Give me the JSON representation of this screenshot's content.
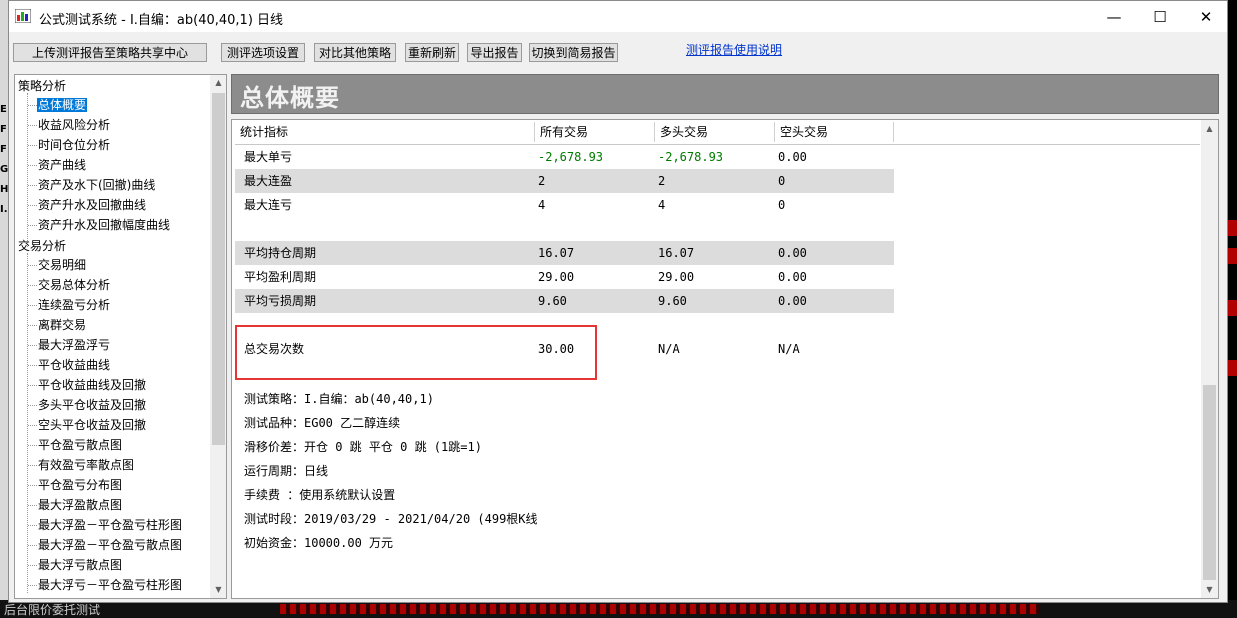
{
  "window": {
    "title": "公式测试系统 - I.自编：ab(40,40,1) 日线",
    "controls": {
      "minimize": "—",
      "maximize": "☐",
      "close": "✕"
    }
  },
  "toolbar": {
    "upload": "上传测评报告至策略共享中心",
    "options": "测评选项设置",
    "compare": "对比其他策略",
    "refresh": "重新刷新",
    "export": "导出报告",
    "simple": "切换到简易报告",
    "help_link": "测评报告使用说明"
  },
  "tree": {
    "group1": "策略分析",
    "group1_items": [
      "总体概要",
      "收益风险分析",
      "时间仓位分析",
      "资产曲线",
      "资产及水下(回撤)曲线",
      "资产升水及回撤曲线",
      "资产升水及回撤幅度曲线"
    ],
    "group2": "交易分析",
    "group2_items": [
      "交易明细",
      "交易总体分析",
      "连续盈亏分析",
      "离群交易",
      "最大浮盈浮亏",
      "平仓收益曲线",
      "平仓收益曲线及回撤",
      "多头平仓收益及回撤",
      "空头平仓收益及回撤",
      "平仓盈亏散点图",
      "有效盈亏率散点图",
      "平仓盈亏分布图",
      "最大浮盈散点图",
      "最大浮盈－平仓盈亏柱形图",
      "最大浮盈－平仓盈亏散点图",
      "最大浮亏散点图",
      "最大浮亏－平仓盈亏柱形图"
    ]
  },
  "banner": {
    "title": "总体概要"
  },
  "table": {
    "headers": [
      "统计指标",
      "所有交易",
      "多头交易",
      "空头交易"
    ],
    "rows": [
      {
        "label": "最大单亏",
        "all": "-2,678.93",
        "long": "-2,678.93",
        "short": "0.00"
      },
      {
        "label": "最大连盈",
        "all": "2",
        "long": "2",
        "short": "0"
      },
      {
        "label": "最大连亏",
        "all": "4",
        "long": "4",
        "short": "0"
      },
      {
        "label": "平均持仓周期",
        "all": "16.07",
        "long": "16.07",
        "short": "0.00"
      },
      {
        "label": "平均盈利周期",
        "all": "29.00",
        "long": "29.00",
        "short": "0.00"
      },
      {
        "label": "平均亏损周期",
        "all": "9.60",
        "long": "9.60",
        "short": "0.00"
      },
      {
        "label": "总交易次数",
        "all": "30.00",
        "long": "N/A",
        "short": "N/A"
      }
    ]
  },
  "info": {
    "strategy": "测试策略：I.自编：ab(40,40,1)",
    "product": "测试品种：EG00 乙二醇连续",
    "slippage": "滑移价差：开仓 0 跳 平仓 0 跳 (1跳=1)",
    "period": "运行周期：日线",
    "fee": "手续费  ：使用系统默认设置",
    "range": "测试时段：2019/03/29 - 2021/04/20 (499根K线",
    "capital": "初始资金：10000.00 万元"
  },
  "background": {
    "left_letters": [
      "E",
      "F",
      "F",
      "G",
      "H",
      "I."
    ],
    "bottom_text": "后台限价委托测试"
  },
  "colors": {
    "selection": "#0078d7",
    "negative": "#007a00",
    "highlight_box": "#e53535",
    "banner": "#8c8c8c"
  }
}
